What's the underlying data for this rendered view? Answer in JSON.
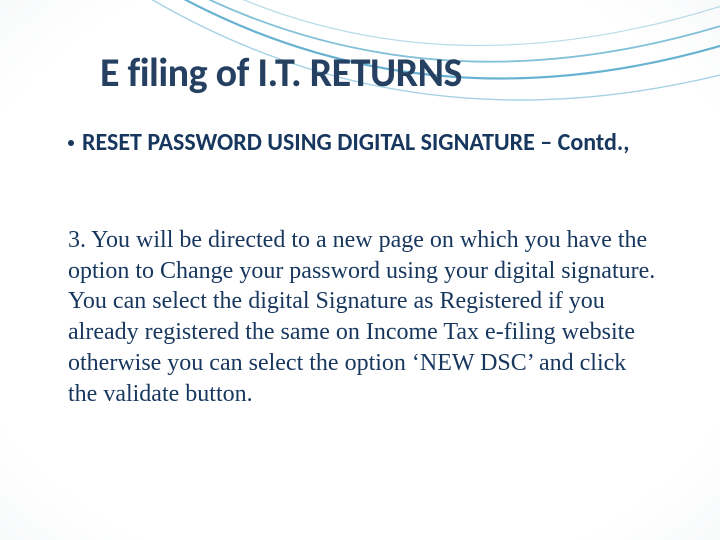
{
  "slide": {
    "title": "E filing of I.T. RETURNS",
    "subtitle": "RESET PASSWORD USING DIGITAL SIGNATURE – Contd.,",
    "body": "3. You will be directed to a new page on which you have the option to Change your password using your digital signature. You can select the digital Signature as Registered if you already registered the same on Income Tax e-filing website otherwise you can select the option ‘NEW DSC’ and click the validate button."
  }
}
